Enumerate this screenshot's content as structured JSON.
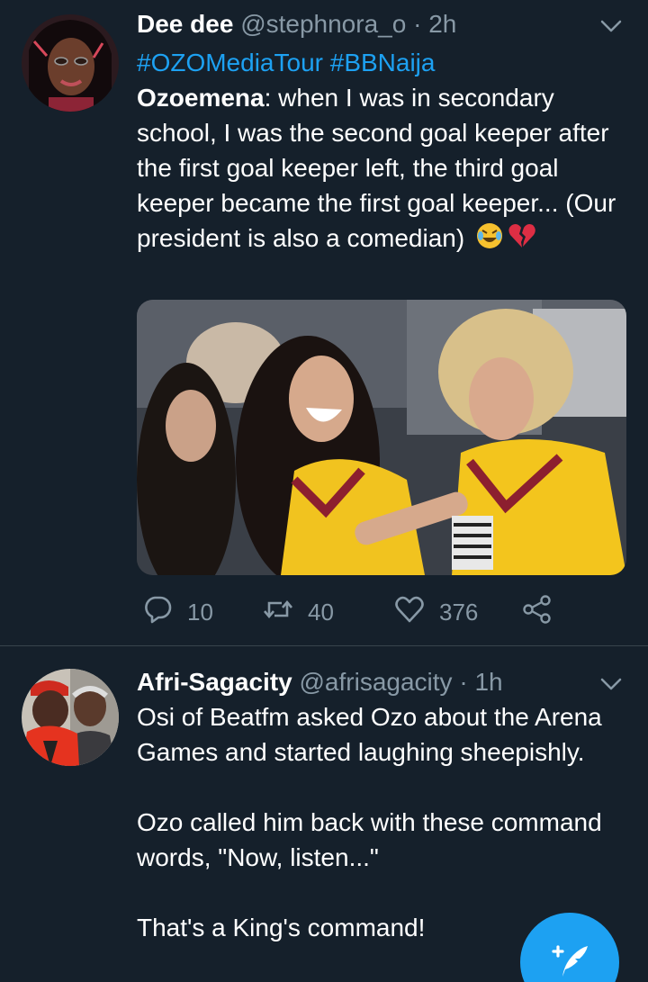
{
  "tweets": [
    {
      "name": "Dee dee",
      "handle": "@stephnora_o",
      "dot": "·",
      "time": "2h",
      "hashtags": "#OZOMediaTour #BBNaija",
      "speaker": "Ozoemena",
      "text": ": when I was in secondary school, I was the second goal keeper after the first goal keeper left, the third goal keeper became the first goal keeper... (Our president is also a comedian)",
      "emojis": [
        "rolling-on-floor-laughing-emoji",
        "broken-heart-emoji"
      ],
      "stats": {
        "replies": "10",
        "retweets": "40",
        "likes": "376"
      }
    },
    {
      "name": "Afri-Sagacity",
      "handle": "@afrisagacity",
      "dot": "·",
      "time": "1h",
      "paragraphs": [
        "Osi of Beatfm asked Ozo about the Arena Games and started laughing sheepishly.",
        "Ozo called him back with these command words, \"Now, listen...\"",
        "That's a King's command!"
      ]
    }
  ],
  "icons": {
    "reply": "reply-icon",
    "retweet": "retweet-icon",
    "like": "heart-icon",
    "share": "share-icon",
    "more": "chevron-down-icon",
    "compose": "compose-tweet-icon"
  },
  "colors": {
    "background": "#15202b",
    "accent": "#1da1f2",
    "secondary_text": "#8899a6",
    "divider": "#38444d"
  }
}
